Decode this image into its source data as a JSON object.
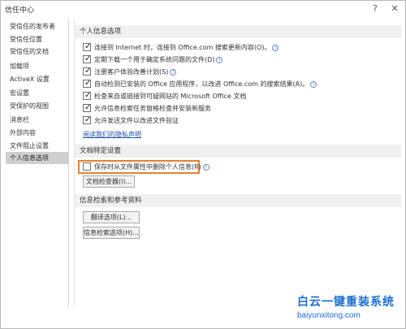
{
  "window": {
    "title": "信任中心",
    "help_glyph": "?",
    "close_glyph": "✕"
  },
  "sidebar": {
    "items": [
      {
        "label": "受信任的发布者"
      },
      {
        "label": "受信任位置"
      },
      {
        "label": "受信任的文档"
      },
      {
        "label": "加载项"
      },
      {
        "label": "ActiveX 设置"
      },
      {
        "label": "宏设置"
      },
      {
        "label": "受保护的视图"
      },
      {
        "label": "消息栏"
      },
      {
        "label": "外部内容"
      },
      {
        "label": "文件阻止设置"
      },
      {
        "label": "个人信息选项",
        "selected": true
      }
    ]
  },
  "personal": {
    "header": "个人信息选项",
    "options": [
      {
        "label": "连接到 Internet 时，连接到 Office.com 搜索更新内容(O)。",
        "checked": true,
        "info": true
      },
      {
        "label": "定期下载一个用于确定系统问题的文件(D)",
        "checked": true,
        "info": true
      },
      {
        "label": "注册客户体验改善计划(S)",
        "checked": true,
        "info": true
      },
      {
        "label": "自动检测已安装的 Office 应用程序，以改进 Office.com 的搜索结果(A)。",
        "checked": true,
        "info": true
      },
      {
        "label": "检查来自或链接到可疑网站的 Microsoft Office 文档",
        "checked": true,
        "info": false
      },
      {
        "label": "允许信息检索任务窗格检查并安装新服务",
        "checked": true,
        "info": false
      },
      {
        "label": "允许发送文件以改进文件验证",
        "checked": true,
        "info": false
      }
    ],
    "privacy_link": "阅读我们的隐私声明"
  },
  "document": {
    "header": "文档特定设置",
    "remove_info": {
      "label": "保存时从文件属性中删除个人信息(R)",
      "checked": false,
      "info": true
    },
    "inspector_button": "文档检查器(I)..."
  },
  "research": {
    "header": "信息检索和参考资料",
    "translation_button": "翻译选项(L)...",
    "research_button": "信息检索选项(H)..."
  },
  "watermark": {
    "logo": "白云一键重装系统",
    "url": "baiyunxitong.com"
  },
  "colors": {
    "highlight": "#e7822f",
    "link": "#1f4fa8",
    "watermark": "#1b6fd0",
    "selected": "#cfcfcf"
  }
}
